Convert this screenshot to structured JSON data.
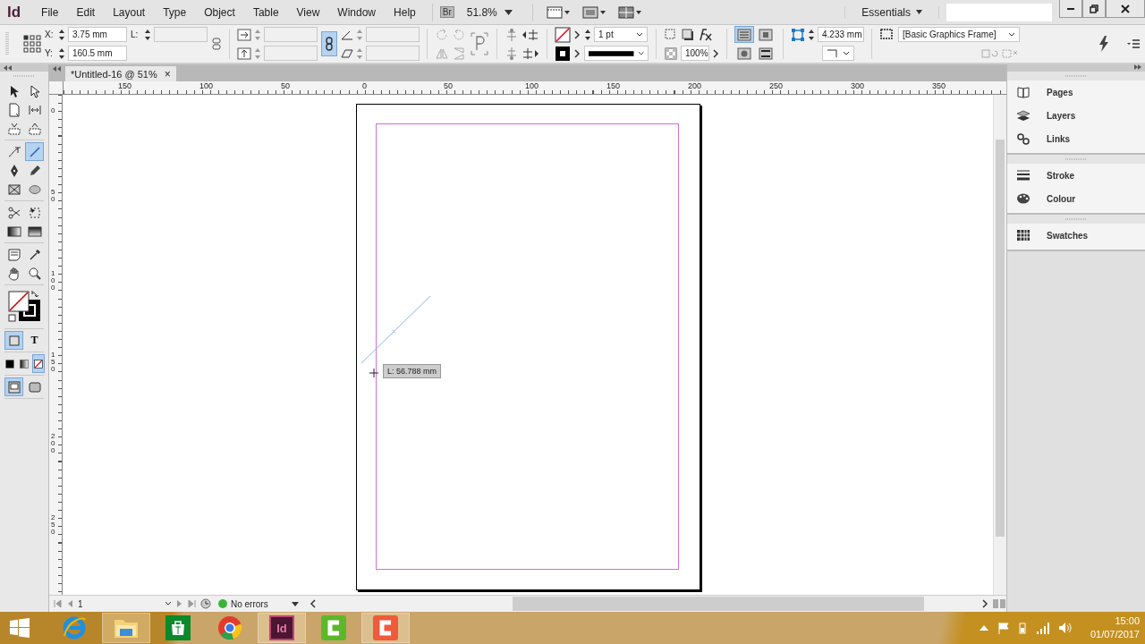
{
  "app": {
    "logo": "Id",
    "menu": [
      "File",
      "Edit",
      "Layout",
      "Type",
      "Object",
      "Table",
      "View",
      "Window",
      "Help"
    ],
    "bridge": "Br",
    "zoom": "51.8%",
    "workspace": "Essentials"
  },
  "control": {
    "x_label": "X:",
    "x": "3.75 mm",
    "y_label": "Y:",
    "y": "160.5 mm",
    "l_label": "L:",
    "constrain_on": true,
    "stroke_weight": "1 pt",
    "opacity": "100%",
    "wrap": [
      {
        "selected": true
      },
      {
        "selected": false
      },
      {
        "selected": false
      },
      {
        "selected": false
      }
    ],
    "corner_size": "4.233 mm",
    "object_style": "[Basic Graphics Frame]"
  },
  "tool_groups": [
    {
      "kind": "tools",
      "rows": [
        [
          {
            "kind": "selection",
            "selected": false
          },
          {
            "kind": "direct-selection",
            "selected": false
          }
        ],
        [
          {
            "kind": "page",
            "selected": false
          },
          {
            "kind": "gap",
            "selected": false
          }
        ],
        [
          {
            "kind": "content-collector",
            "selected": false
          },
          {
            "kind": "content-placer",
            "selected": false
          }
        ]
      ]
    },
    {
      "kind": "tools",
      "rows": [
        [
          {
            "kind": "path-type",
            "selected": false
          },
          {
            "kind": "line",
            "selected": true
          }
        ],
        [
          {
            "kind": "pen",
            "selected": false
          },
          {
            "kind": "pencil",
            "selected": false
          }
        ],
        [
          {
            "kind": "rectangle-frame",
            "selected": false
          },
          {
            "kind": "ellipse",
            "selected": false
          }
        ]
      ]
    },
    {
      "kind": "tools",
      "rows": [
        [
          {
            "kind": "scissors",
            "selected": false
          },
          {
            "kind": "free-transform",
            "selected": false
          }
        ],
        [
          {
            "kind": "gradient-swatch",
            "selected": false
          },
          {
            "kind": "gradient-feather",
            "selected": false
          }
        ]
      ]
    },
    {
      "kind": "tools",
      "rows": [
        [
          {
            "kind": "note",
            "selected": false
          },
          {
            "kind": "eyedropper",
            "selected": false
          }
        ],
        [
          {
            "kind": "hand",
            "selected": false
          },
          {
            "kind": "zoom",
            "selected": false
          }
        ]
      ]
    },
    {
      "kind": "fill_stroke"
    },
    {
      "kind": "tools",
      "rows": [
        [
          {
            "kind": "container",
            "selected": true
          },
          {
            "kind": "text",
            "label": "T",
            "selected": false
          }
        ]
      ]
    },
    {
      "kind": "tools",
      "rows": [
        [
          {
            "kind": "apply-colour",
            "selected": false
          },
          {
            "kind": "apply-gradient",
            "selected": false
          },
          {
            "kind": "apply-none",
            "selected": true
          }
        ]
      ]
    },
    {
      "kind": "tools",
      "rows": [
        [
          {
            "kind": "normal-mode",
            "selected": true
          },
          {
            "kind": "preview-mode",
            "selected": false
          }
        ]
      ]
    }
  ],
  "document": {
    "tab": {
      "title": "*Untitled-16 @ 51%",
      "close": "×"
    },
    "ruler": {
      "h": [
        "150",
        "100",
        "50",
        "0",
        "50",
        "100",
        "150",
        "200",
        "250",
        "300",
        "350"
      ],
      "v": [
        "0",
        "50",
        "100",
        "150",
        "200",
        "250"
      ]
    },
    "tooltip": "L: 56.788 mm",
    "status": {
      "page": "1",
      "preflight": "No errors"
    }
  },
  "panels": [
    {
      "items": [
        {
          "kind": "pages",
          "label": "Pages"
        },
        {
          "kind": "layers",
          "label": "Layers"
        },
        {
          "kind": "links",
          "label": "Links"
        }
      ]
    },
    {
      "items": [
        {
          "kind": "stroke",
          "label": "Stroke"
        },
        {
          "kind": "colour",
          "label": "Colour"
        }
      ]
    },
    {
      "items": [
        {
          "kind": "swatches",
          "label": "Swatches"
        }
      ]
    }
  ],
  "taskbar": {
    "apps": [
      {
        "kind": "ie",
        "running": false
      },
      {
        "kind": "folder",
        "running": true
      },
      {
        "kind": "store",
        "running": false
      },
      {
        "kind": "chrome",
        "running": false
      },
      {
        "kind": "indesign",
        "label": "Id",
        "running": true
      },
      {
        "kind": "camtasia",
        "running": false
      },
      {
        "kind": "recorder",
        "running": true
      }
    ],
    "time": "15:00",
    "date": "01/07/2017"
  }
}
